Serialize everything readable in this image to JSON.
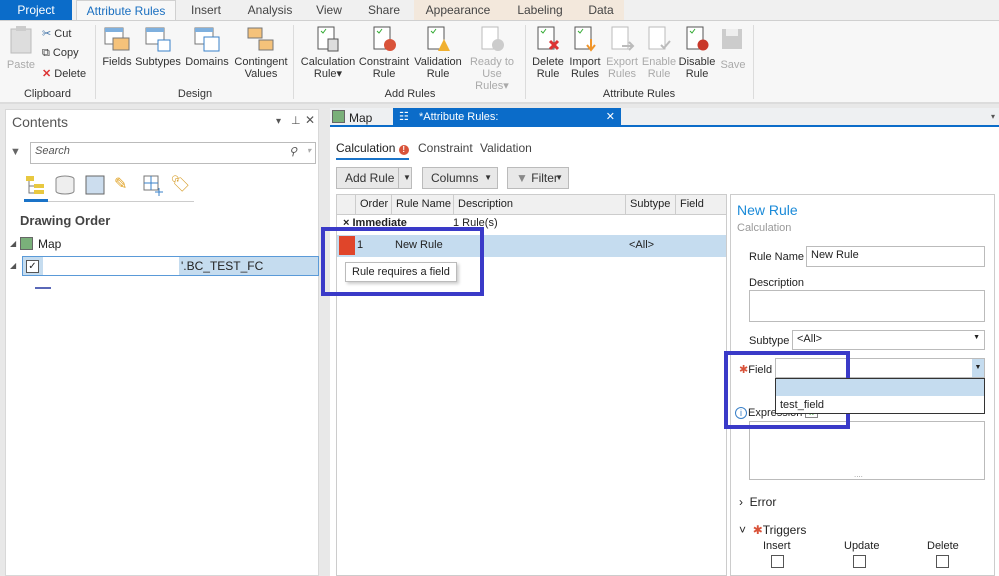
{
  "ribbon_tabs": [
    "Project",
    "Attribute Rules",
    "Insert",
    "Analysis",
    "View",
    "Share",
    "Appearance",
    "Labeling",
    "Data"
  ],
  "clipboard": {
    "paste": "Paste",
    "cut": "Cut",
    "copy": "Copy",
    "delete": "Delete",
    "group": "Clipboard"
  },
  "design": {
    "fields": "Fields",
    "subtypes": "Subtypes",
    "domains": "Domains",
    "contingent1": "Contingent",
    "contingent2": "Values",
    "group": "Design"
  },
  "add_rules": {
    "calc1": "Calculation",
    "calc2": "Rule",
    "cons1": "Constraint",
    "cons2": "Rule",
    "val1": "Validation",
    "val2": "Rule",
    "ready1": "Ready to",
    "ready2": "Use Rules",
    "group": "Add Rules"
  },
  "attr_rules": {
    "del1": "Delete",
    "del2": "Rule",
    "imp1": "Import",
    "imp2": "Rules",
    "exp1": "Export",
    "exp2": "Rules",
    "en1": "Enable",
    "en2": "Rule",
    "dis1": "Disable",
    "dis2": "Rule",
    "save": "Save",
    "group": "Attribute Rules"
  },
  "contents": {
    "title": "Contents",
    "search_placeholder": "Search",
    "drawing_order": "Drawing Order",
    "map": "Map",
    "layer_suffix": "'.BC_TEST_FC"
  },
  "doc_tabs": {
    "map": "Map",
    "rules": "*Attribute Rules: \"O...NTS\".BC_TEST_FC"
  },
  "rule_tabs": {
    "calculation": "Calculation",
    "constraint": "Constraint",
    "validation": "Validation"
  },
  "toolbar": {
    "add_rule": "Add Rule",
    "columns": "Columns",
    "filter": "Filter"
  },
  "table": {
    "headers": [
      "Order",
      "Rule Name",
      "Description",
      "Subtype",
      "Field"
    ],
    "group": "Immediate",
    "group_count": "1 Rule(s)",
    "row": {
      "order": "1",
      "name": "New Rule",
      "description": "",
      "subtype": "<All>",
      "field": ""
    },
    "tooltip": "Rule requires a field"
  },
  "details": {
    "title": "New Rule",
    "subtitle": "Calculation",
    "rule_name_label": "Rule Name",
    "rule_name": "New Rule",
    "description_label": "Description",
    "subtype_label": "Subtype",
    "subtype": "<All>",
    "field_label": "Field",
    "field_options": [
      "",
      "test_field"
    ],
    "expression_label": "Expression",
    "error": "Error",
    "triggers": "Triggers",
    "insert": "Insert",
    "update": "Update",
    "delete": "Delete"
  },
  "colors": {
    "accent": "#1a73c8",
    "error": "#e0452a",
    "selected": "#c5dcef",
    "highlight": "#3a3ac8"
  }
}
